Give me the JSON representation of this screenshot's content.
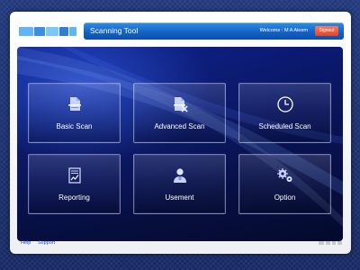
{
  "header": {
    "title": "Scanning Tool",
    "welcome": "Welcome : M A Aleem",
    "signout_label": "Signout"
  },
  "logo": {
    "blocks": [
      "#5fb6f2",
      "#3a8fe0",
      "#79c8f7",
      "#2f7ed2"
    ]
  },
  "tiles": [
    {
      "label": "Basic Scan",
      "icon": "document-scan-icon"
    },
    {
      "label": "Advanced Scan",
      "icon": "document-tools-icon"
    },
    {
      "label": "Scheduled Scan",
      "icon": "clock-icon"
    },
    {
      "label": "Reporting",
      "icon": "report-chart-icon"
    },
    {
      "label": "Usement",
      "icon": "user-icon"
    },
    {
      "label": "Option",
      "icon": "gears-icon"
    }
  ],
  "footer": {
    "help_label": "Help",
    "support_label": "Support"
  },
  "colors": {
    "accent": "#1463c6",
    "signout": "#e0442a",
    "stage": "#0a1660"
  }
}
